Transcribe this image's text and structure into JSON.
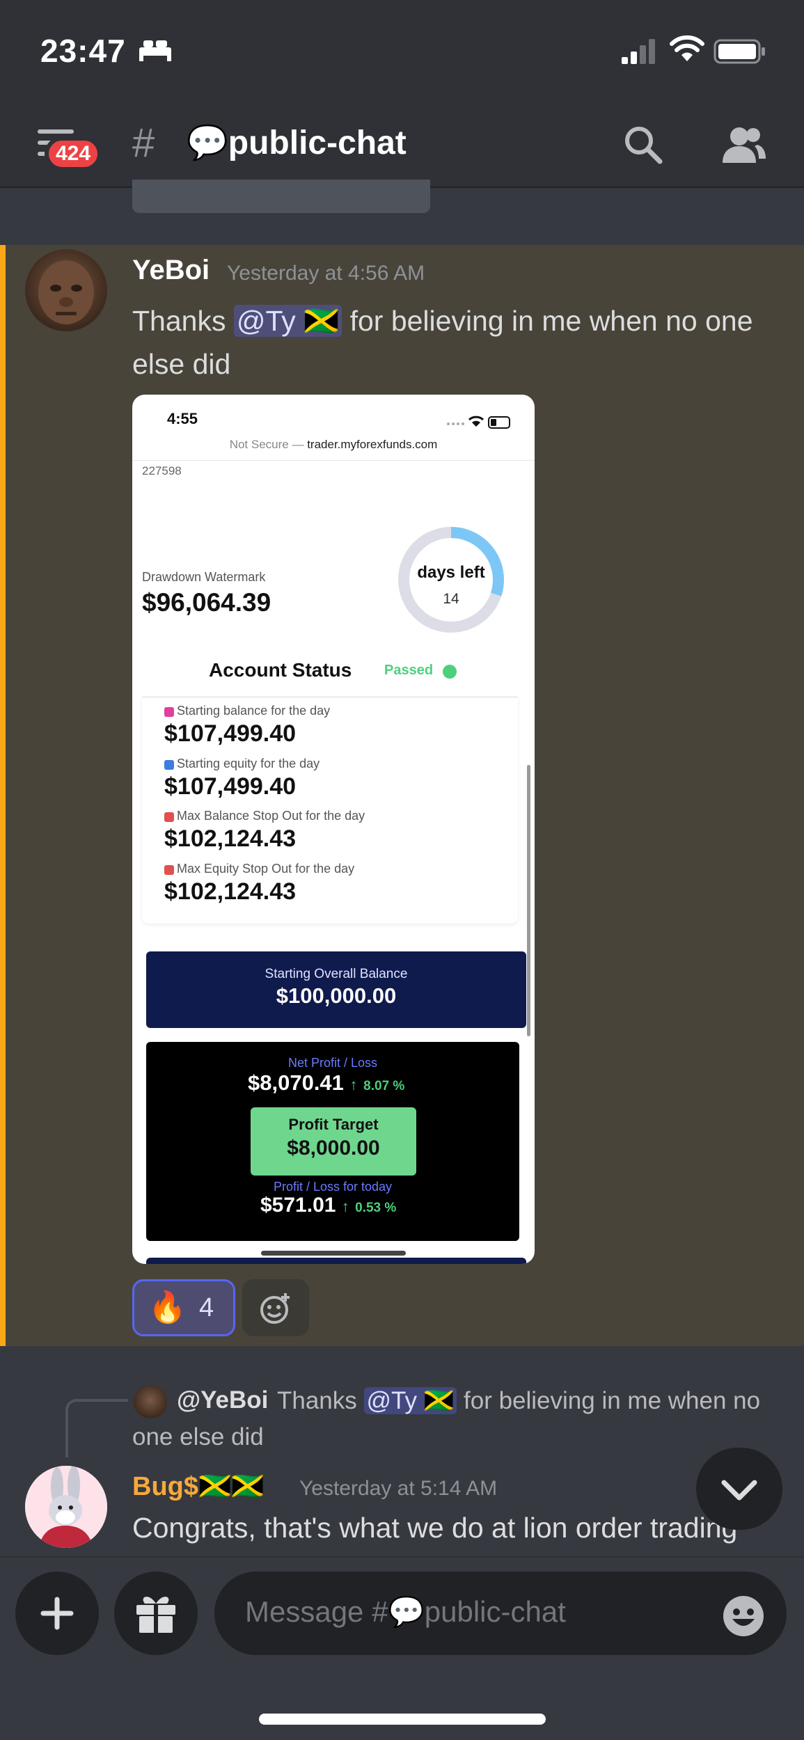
{
  "status_bar": {
    "time": "23:47"
  },
  "header": {
    "unread_count": "424",
    "hash": "#",
    "channel": "💬public-chat"
  },
  "message": {
    "author": "YeBoi",
    "time": "Yesterday at 4:56 AM",
    "text_before": "Thanks ",
    "mention": "@Ty 🇯🇲",
    "text_after": " for believing in me when no one",
    "text_line2": "else did",
    "reaction": {
      "emoji": "🔥",
      "count": "4"
    }
  },
  "screenshot": {
    "time": "4:55",
    "url_prefix": "Not Secure — ",
    "url": "trader.myforexfunds.com",
    "account_id": "227598",
    "drawdown_label": "Drawdown Watermark",
    "drawdown_value": "$96,064.39",
    "days_label": "days left",
    "days_value": "14",
    "days_fraction": 0.3,
    "status_title": "Account Status",
    "status_value": "Passed",
    "rows": [
      {
        "label": "Starting balance for the day",
        "value": "$107,499.40",
        "color": "#e0409a"
      },
      {
        "label": "Starting equity for the day",
        "value": "$107,499.40",
        "color": "#3b7de0"
      },
      {
        "label": "Max Balance Stop Out for the day",
        "value": "$102,124.43",
        "color": "#e05050"
      },
      {
        "label": "Max Equity Stop Out for the day",
        "value": "$102,124.43",
        "color": "#e05050"
      }
    ],
    "overall_label": "Starting Overall Balance",
    "overall_value": "$100,000.00",
    "net_label": "Net Profit / Loss",
    "net_value": "$8,070.41",
    "net_pct": "8.07 %",
    "target_label": "Profit Target",
    "target_value": "$8,000.00",
    "today_label": "Profit / Loss for today",
    "today_value": "$571.01",
    "today_pct": "0.53 %"
  },
  "reply": {
    "author": "@YeBoi",
    "text_before": "Thanks ",
    "mention": "@Ty 🇯🇲",
    "text_after": " for believing in me when no",
    "text_line2": "one else did"
  },
  "message2": {
    "author": "Bug$🇯🇲🇯🇲",
    "time": "Yesterday at 5:14 AM",
    "text": "Congrats, that's what we do at lion order trading"
  },
  "composer": {
    "placeholder": "Message #💬public-chat"
  }
}
